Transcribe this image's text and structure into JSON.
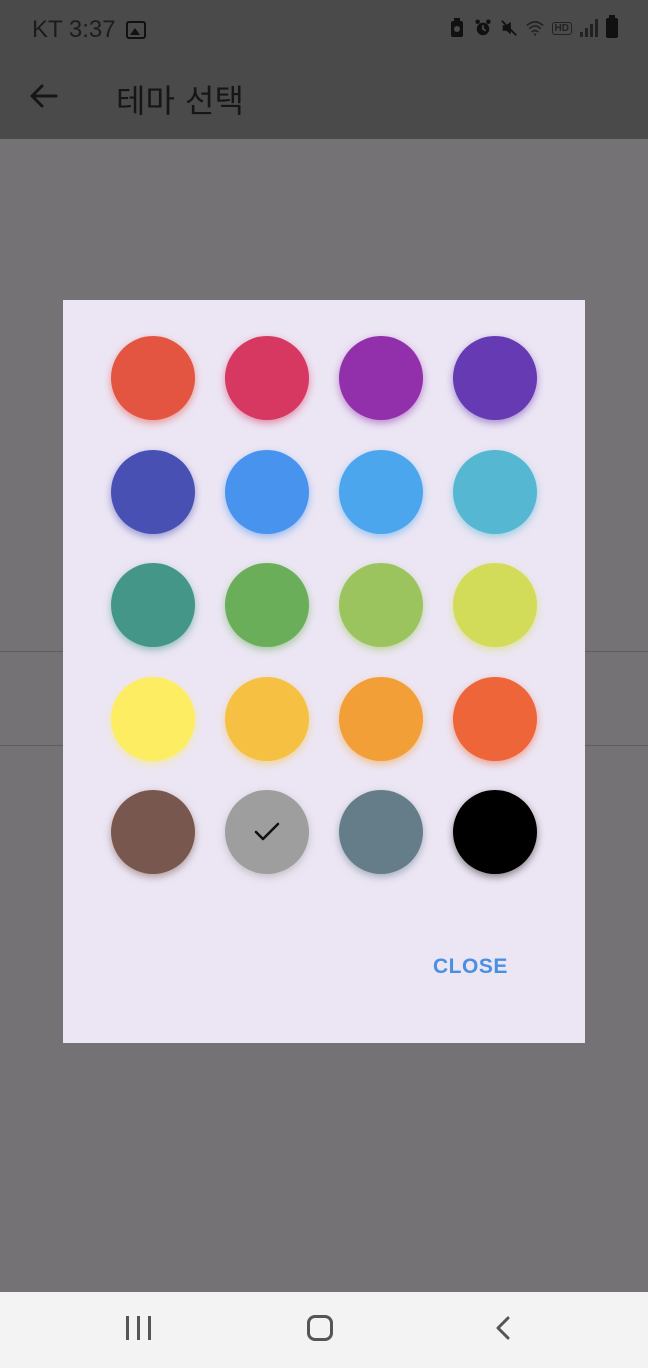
{
  "status_bar": {
    "carrier_time": "KT 3:37",
    "hd_label": "HD"
  },
  "app_bar": {
    "title": "테마 선택"
  },
  "dialog": {
    "close_label": "CLOSE",
    "selected_index": 17,
    "colors": [
      "#e35441",
      "#d63861",
      "#9130aa",
      "#653ab2",
      "#4850b3",
      "#4893ee",
      "#4ba6ee",
      "#55b7d1",
      "#449689",
      "#6aae5a",
      "#9bc45e",
      "#d2dc58",
      "#fded63",
      "#f6c142",
      "#f29f38",
      "#ed6538",
      "#78584e",
      "#9e9e9e",
      "#657c89",
      "#000000"
    ]
  },
  "icons": {
    "back": "arrow-left-icon",
    "check": "check-icon",
    "nav_recent": "recent-apps-icon",
    "nav_home": "home-icon",
    "nav_back": "chevron-left-icon"
  }
}
